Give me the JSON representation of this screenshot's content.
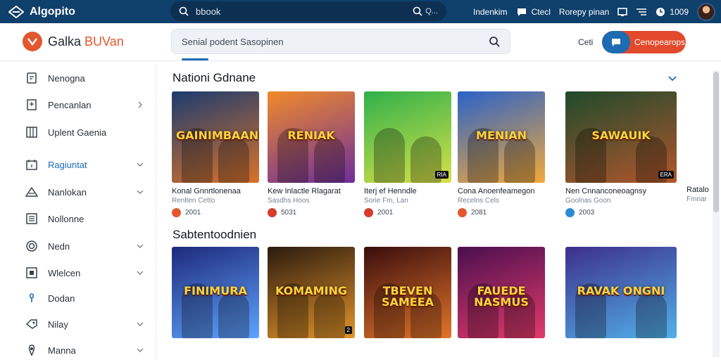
{
  "topbar": {
    "brand": "Algopito",
    "search_query": "bbook",
    "search_kbd": "Q...",
    "links": [
      "Indenkim",
      "Ctecl",
      "Rorepy pinan"
    ],
    "count": "1009"
  },
  "header": {
    "site_name_a": "Galka ",
    "site_name_b": "BUVan",
    "search_placeholder": "Senial podent  Sasopinen",
    "link": "Ceti",
    "cta_label": "Cenopearops"
  },
  "sidebar": {
    "items": [
      {
        "label": "Nenogna",
        "icon": "document-icon",
        "chevron": false,
        "active": false
      },
      {
        "label": "Pencanlan",
        "icon": "book-icon",
        "chevron": true,
        "active": false
      },
      {
        "label": "Uplent Gaenia",
        "icon": "grid-icon",
        "chevron": false,
        "active": false
      },
      {
        "label": "Ragiuntat",
        "icon": "calendar-icon",
        "chevron": true,
        "active": true
      },
      {
        "label": "Nanlokan",
        "icon": "warning-icon",
        "chevron": true,
        "active": false
      },
      {
        "label": "Nollonne",
        "icon": "list-icon",
        "chevron": false,
        "active": false
      },
      {
        "label": "Nedn",
        "icon": "target-icon",
        "chevron": true,
        "active": false
      },
      {
        "label": "Wlelcen",
        "icon": "frame-icon",
        "chevron": true,
        "active": false
      },
      {
        "label": "Dodan",
        "icon": "user-icon",
        "chevron": false,
        "active": false
      },
      {
        "label": "Nilay",
        "icon": "tag-icon",
        "chevron": true,
        "active": false
      },
      {
        "label": "Manna",
        "icon": "pin-icon",
        "chevron": true,
        "active": false
      }
    ]
  },
  "sections": [
    {
      "title": "Nationi Gdnane",
      "cards": [
        {
          "art": "GAINIMBAANK",
          "name": "Konal Gnnrtlonenaa",
          "sub": "Renlten Cetto",
          "meta": "2001",
          "badge": "",
          "colors": [
            "#1c3b6f",
            "#d9732b"
          ],
          "dot": "#e4572e"
        },
        {
          "art": "RENIAK",
          "name": "Kew Inlactle Rlagarat",
          "sub": "Sasdhs Hoos",
          "meta": "5031",
          "badge": "",
          "colors": [
            "#f08a2a",
            "#6d2f9c"
          ],
          "dot": "#d63b2b"
        },
        {
          "art": "",
          "name": "Iterj ef Henndle",
          "sub": "Sorie Fm, Lan",
          "meta": "2001",
          "badge": "RIA",
          "colors": [
            "#2fb14a",
            "#d8e04a"
          ],
          "dot": "#d63b2b"
        },
        {
          "art": "MENIAN",
          "name": "Cona Anoenfeamegon",
          "sub": "Recelns Cels",
          "meta": "2081",
          "badge": "",
          "colors": [
            "#2a62c9",
            "#f2a93b"
          ],
          "dot": "#e4572e"
        },
        {
          "art": "SAWAUIK",
          "name": "Nen Cnnanconeoagnsy",
          "sub": "Goolnas Goon",
          "meta": "2003",
          "badge": "ERA",
          "colors": [
            "#1f4a2b",
            "#b0562c"
          ],
          "dot": "#2c8bd6"
        }
      ]
    },
    {
      "title": "Sabtentoodnien",
      "cards": [
        {
          "art": "FINIMURA",
          "name": "",
          "sub": "",
          "meta": "",
          "badge": "",
          "colors": [
            "#1e2a7a",
            "#5fa3ff"
          ],
          "dot": "#e4572e"
        },
        {
          "art": "KOMAMING",
          "name": "",
          "sub": "",
          "meta": "",
          "badge": "2",
          "colors": [
            "#2b1a0e",
            "#e2942b"
          ],
          "dot": "#e4572e"
        },
        {
          "art": "TBEVEN SAMEEA",
          "name": "",
          "sub": "",
          "meta": "",
          "badge": "",
          "colors": [
            "#3a0d0d",
            "#e2742b"
          ],
          "dot": "#e4572e"
        },
        {
          "art": "FAUEDE NASMUS",
          "name": "",
          "sub": "",
          "meta": "",
          "badge": "",
          "colors": [
            "#4a0f4f",
            "#e23a6b"
          ],
          "dot": "#e4572e"
        },
        {
          "art": "RAVAK ONGNI",
          "name": "",
          "sub": "",
          "meta": "",
          "badge": "",
          "colors": [
            "#3d2f8c",
            "#52b0e8"
          ],
          "dot": "#e4572e"
        }
      ]
    }
  ],
  "partial_card": {
    "name": "Ratalo",
    "sub": "Fmnar"
  },
  "colors": {
    "accent": "#1d6bb3",
    "brand_dark": "#0f3f6b",
    "cta": "#e24a2b"
  }
}
